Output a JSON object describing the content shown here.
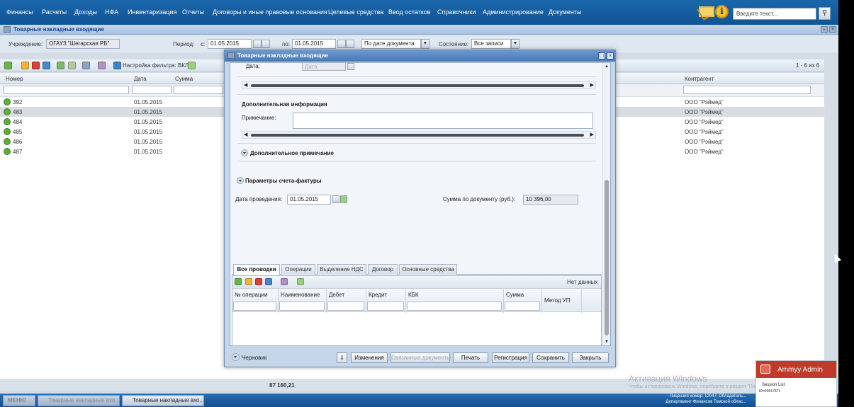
{
  "menu": [
    "Финансы",
    "Расчеты",
    "Доходы",
    "НФА",
    "Инвентаризация",
    "Отчеты",
    "Договоры и иные правовые основания",
    "Целевые средства",
    "Ввод остатков",
    "Справочники",
    "Администрирование",
    "Документы"
  ],
  "search": {
    "placeholder": "Введите текст..."
  },
  "panel": {
    "title": "Товарные накладные входящие"
  },
  "filter": {
    "institution_label": "Учреждение:",
    "institution_value": "ОГАУЗ \"Шегарская РБ\"",
    "period_label": "Период:",
    "from_label": "с:",
    "from_value": "01.05.2015",
    "to_label": "по:",
    "to_value": "01.05.2015",
    "date_mode": "По дате документа",
    "state_label": "Состояние:",
    "state_value": "Все записи"
  },
  "toolbar": {
    "filter_settings": "Настройка фильтра: ВКЛ",
    "paging": "1 - 6 из 6"
  },
  "table": {
    "columns": [
      "Номер",
      "Дата",
      "Сумма",
      "Контрагент"
    ],
    "rows": [
      {
        "num": "392",
        "date": "01.05.2015",
        "contractor": "ООО \"Рэймед\""
      },
      {
        "num": "483",
        "date": "01.05.2015",
        "contractor": "ООО \"Рэймед\""
      },
      {
        "num": "484",
        "date": "01.05.2015",
        "contractor": "ООО \"Рэймед\""
      },
      {
        "num": "485",
        "date": "01.05.2015",
        "contractor": "ООО \"Рэймед\""
      },
      {
        "num": "486",
        "date": "01.05.2015",
        "contractor": "ООО \"Рэймед\""
      },
      {
        "num": "487",
        "date": "01.05.2015",
        "contractor": "ООО \"Рэймед\""
      }
    ],
    "total": "87 160,21"
  },
  "modal": {
    "title": "Товарные накладные входящие",
    "date_label": "Дата:",
    "date_placeholder": "Дата",
    "additional_info": "Дополнительная информация",
    "note_label": "Примечание:",
    "additional_note": "Дополнительное примечание",
    "invoice_params": "Параметры счета-фактуры",
    "posting_date_label": "Дата проведения:",
    "posting_date": "01.05.2015",
    "doc_sum_label": "Сумма по документу (руб.):",
    "doc_sum": "10 396,00",
    "tabs": [
      "Все проводки",
      "Операции",
      "Выделение НДС",
      "Договор",
      "Основные средства"
    ],
    "no_data": "Нет данных",
    "grid_columns": [
      "№ операции",
      "Наименование",
      "Дебет",
      "Кредит",
      "КБК",
      "Сумма",
      "Метод УП"
    ],
    "status": "Черновик",
    "buttons": {
      "changes": "Изменения",
      "linked": "Связанные документы",
      "print": "Печать",
      "register": "Регистрация",
      "save": "Сохранить",
      "close": "Закрыть"
    }
  },
  "taskbar": {
    "start": "МЕНЮ",
    "task1": "Товарные накладные вхо...",
    "task2": "Товарные накладные вхо...",
    "status_url": "http://localhost:8080/...",
    "license1": "Лицензия номер: 12047; Обладатель...",
    "license2": "Департамент Финансов Томской облас..."
  },
  "watermark": {
    "line1": "Активация Windows",
    "line2": "Чтобы активировать Windows, перейдите в раздел \"Параметры\"."
  },
  "ammyy": {
    "title": "Ammyy Admin",
    "session": "Session List",
    "id": "ID=93617871"
  }
}
